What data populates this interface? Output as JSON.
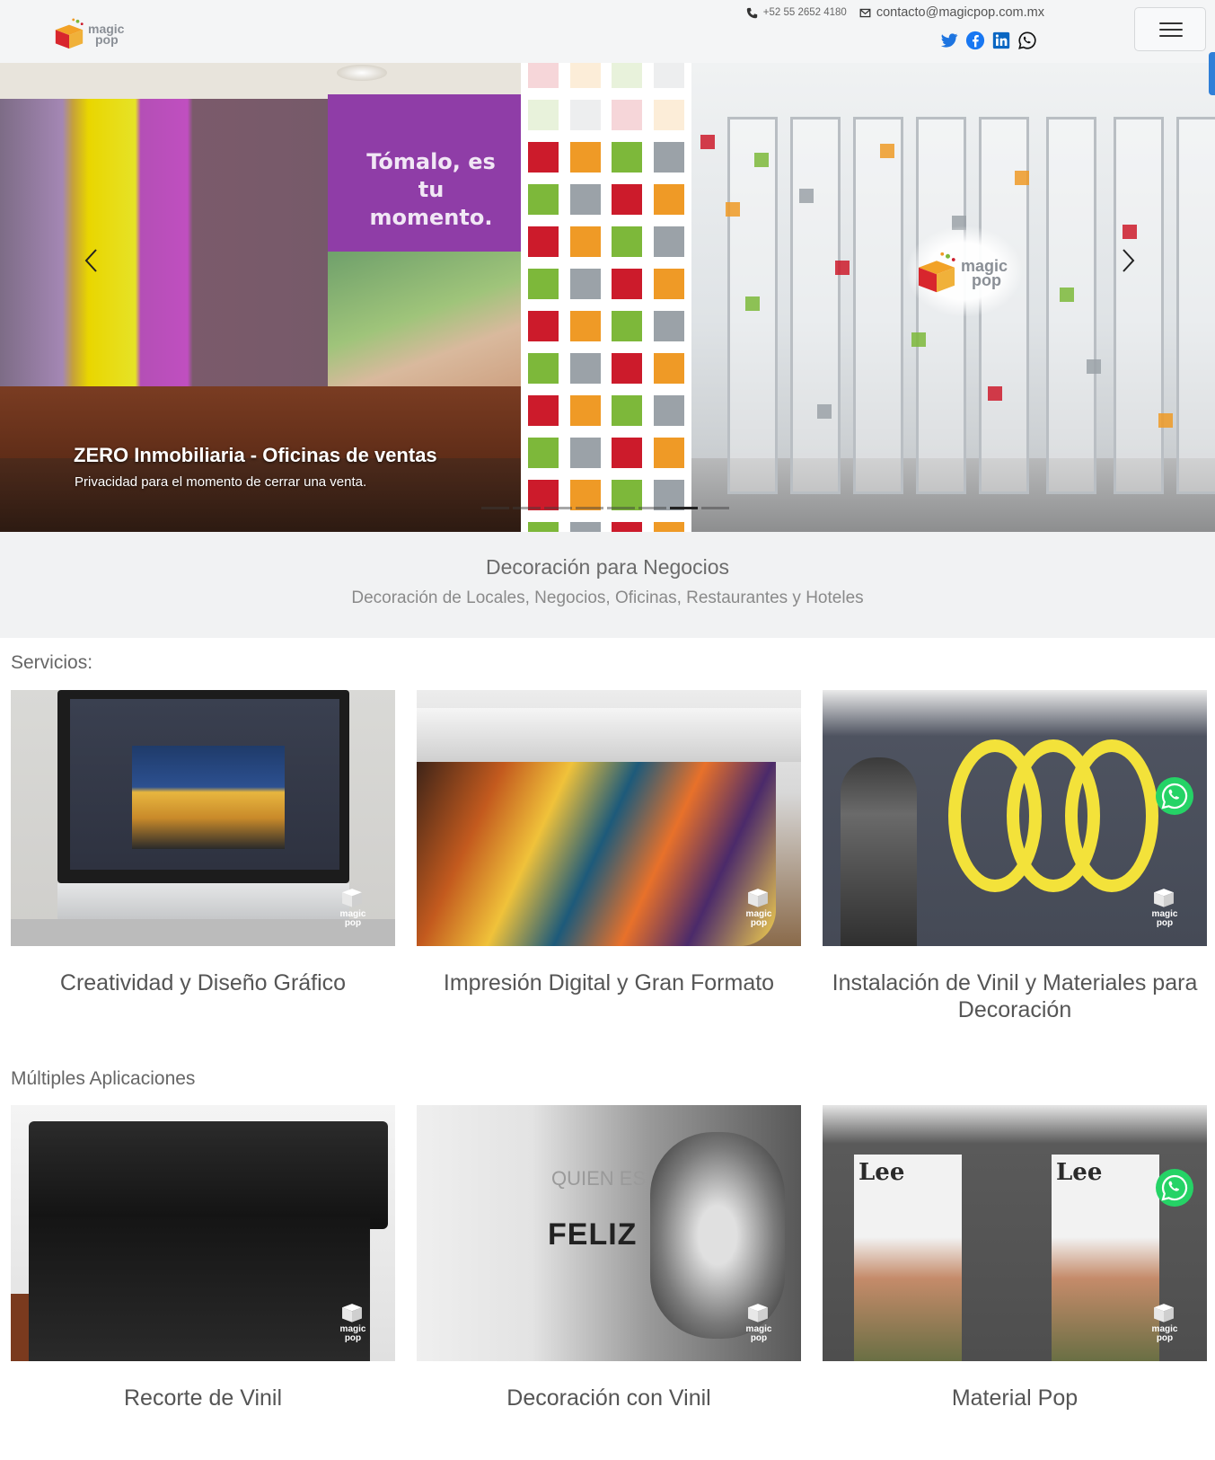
{
  "header": {
    "logo": {
      "line1": "magic",
      "line2": "pop"
    },
    "phone": "+52 55 2652 4180",
    "email": "contacto@magicpop.com.mx",
    "social": [
      "twitter-icon",
      "facebook-icon",
      "linkedin-icon",
      "whatsapp-icon"
    ]
  },
  "hero": {
    "slogan": "Tómalo, es tu momento.",
    "badge": {
      "line1": "magic",
      "line2": "pop"
    },
    "caption_title": "ZERO Inmobiliaria - Oficinas de ventas",
    "caption_text": "Privacidad para el momento de cerrar una venta.",
    "indicator_count": 8,
    "active_indicator": 7
  },
  "tagline": {
    "title": "Decoración para Negocios",
    "subtitle": "Decoración de Locales, Negocios, Oficinas, Restaurantes y Hoteles"
  },
  "servicios": {
    "heading": "Servicios:",
    "cards": [
      {
        "title": "Creatividad y Diseño Gráfico"
      },
      {
        "title": "Impresión Digital y Gran Formato"
      },
      {
        "title": "Instalación de Vinil y Materiales para Decoración"
      }
    ]
  },
  "aplicaciones": {
    "heading": "Múltiples Aplicaciones",
    "cards": [
      {
        "title": "Recorte de Vinil"
      },
      {
        "title": "Decoración con Vinil",
        "image_text_small": "QUIEN ES FELIZ",
        "image_text_big": "FELIZ"
      },
      {
        "title": "Material Pop",
        "image_text": "Lee"
      }
    ]
  },
  "watermark": {
    "line1": "magic",
    "line2": "pop"
  },
  "colors": {
    "mosaic_red": "#cc1b2b",
    "mosaic_orange": "#ef9a26",
    "mosaic_green": "#7db83a",
    "mosaic_gray": "#9ba2a8",
    "whatsapp_green": "#25d366",
    "social_blue": "#1877f2"
  }
}
